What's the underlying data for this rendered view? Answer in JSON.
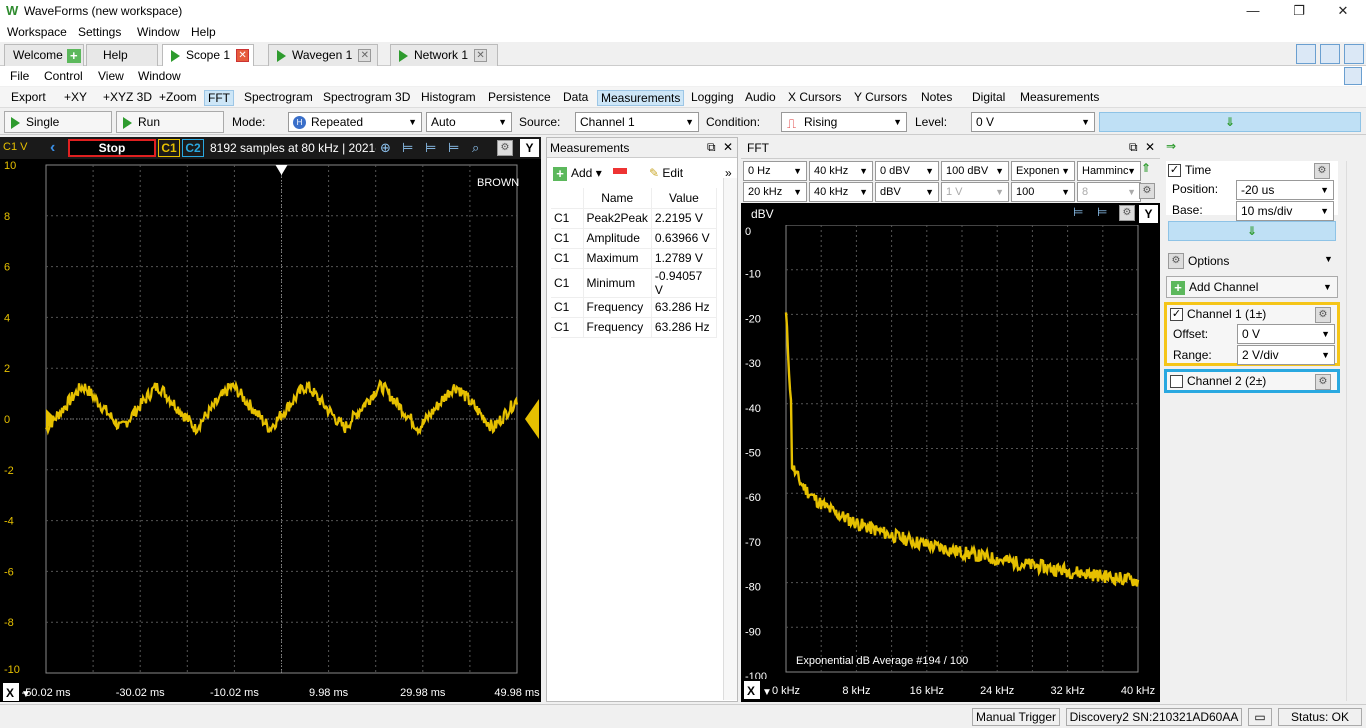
{
  "window": {
    "title": "WaveForms (new workspace)"
  },
  "main_menu": [
    "Workspace",
    "Settings",
    "Window",
    "Help"
  ],
  "doc_tabs": [
    {
      "label": "Welcome",
      "icon": "plus-icon"
    },
    {
      "label": "Help"
    },
    {
      "label": "Scope 1",
      "active": true
    },
    {
      "label": "Wavegen 1"
    },
    {
      "label": "Network 1"
    }
  ],
  "file_menu": [
    "File",
    "Control",
    "View",
    "Window"
  ],
  "toolbar": [
    "Export",
    "+XY",
    "+XYZ 3D",
    "+Zoom",
    "FFT",
    "Spectrogram",
    "Spectrogram 3D",
    "Histogram",
    "Persistence",
    "Data",
    "Measurements",
    "Logging",
    "Audio",
    "X Cursors",
    "Y Cursors",
    "Notes",
    "Digital",
    "Measurements"
  ],
  "toolbar_selected": [
    "FFT",
    "Measurements"
  ],
  "control": {
    "single": "Single",
    "run": "Run",
    "mode_label": "Mode:",
    "mode_value": "Repeated",
    "auto_value": "Auto",
    "source_label": "Source:",
    "source_value": "Channel 1",
    "condition_label": "Condition:",
    "condition_value": "Rising",
    "level_label": "Level:",
    "level_value": "0 V"
  },
  "scope": {
    "channel_label": "C1 V",
    "stop": "Stop",
    "c1": "C1",
    "c2": "C2",
    "info": "8192 samples at 80 kHz | 2021-",
    "y_button": "Y",
    "brown_label": "BROWN",
    "y_ticks": [
      "10",
      "8",
      "6",
      "4",
      "2",
      "0",
      "-2",
      "-4",
      "-6",
      "-8",
      "-10"
    ],
    "x_ticks": [
      "-50.02 ms",
      "-30.02 ms",
      "-10.02 ms",
      "9.98 ms",
      "29.98 ms",
      "49.98 ms"
    ],
    "x_button": "X",
    "trace_color": "#e6c000"
  },
  "measurements": {
    "title": "Measurements",
    "add": "Add",
    "edit": "Edit",
    "col_name": "Name",
    "col_value": "Value",
    "rows": [
      {
        "ch": "C1",
        "name": "Peak2Peak",
        "value": "2.2195 V"
      },
      {
        "ch": "C1",
        "name": "Amplitude",
        "value": "0.63966 V"
      },
      {
        "ch": "C1",
        "name": "Maximum",
        "value": "1.2789 V"
      },
      {
        "ch": "C1",
        "name": "Minimum",
        "value": "-0.94057 V"
      },
      {
        "ch": "C1",
        "name": "Frequency",
        "value": "63.286 Hz"
      },
      {
        "ch": "C1",
        "name": "Frequency",
        "value": "63.286 Hz"
      }
    ]
  },
  "fft": {
    "title": "FFT",
    "row1": [
      "0 Hz",
      "40 kHz",
      "0 dBV",
      "100 dBV",
      "Exponen",
      "Hamminc"
    ],
    "row2": [
      "20 kHz",
      "40 kHz",
      "dBV",
      "1 V",
      "100",
      "8"
    ],
    "y_unit": "dBV",
    "y_ticks": [
      "0",
      "-10",
      "-20",
      "-30",
      "-40",
      "-50",
      "-60",
      "-70",
      "-80",
      "-90",
      "-100"
    ],
    "x_ticks": [
      "0 kHz",
      "8 kHz",
      "16 kHz",
      "24 kHz",
      "32 kHz",
      "40 kHz"
    ],
    "footer": "Exponential dB Average #194 / 100",
    "x_button": "X",
    "y_button": "Y"
  },
  "side": {
    "time_label": "Time",
    "position_label": "Position:",
    "position_value": "-20 us",
    "base_label": "Base:",
    "base_value": "10 ms/div",
    "options": "Options",
    "add_channel": "Add Channel",
    "ch1_label": "Channel 1 (1±)",
    "offset_label": "Offset:",
    "offset_value": "0 V",
    "range_label": "Range:",
    "range_value": "2 V/div",
    "ch2_label": "Channel 2 (2±)",
    "ch1_color": "#f5c518",
    "ch2_color": "#29a8e0"
  },
  "status": {
    "manual_trigger": "Manual Trigger",
    "device": "Discovery2 SN:210321AD60AA",
    "status": "Status: OK"
  }
}
